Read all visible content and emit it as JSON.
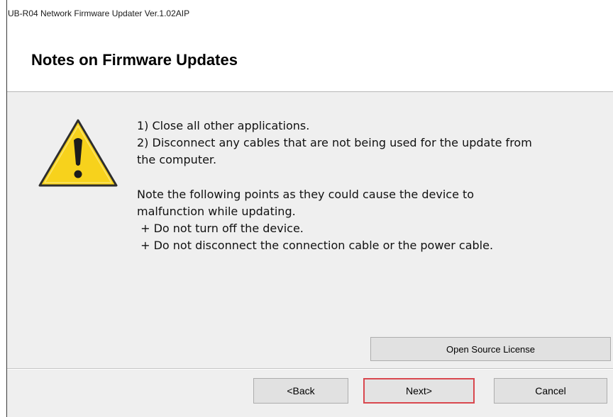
{
  "window": {
    "title": "UB-R04 Network Firmware Updater Ver.1.02AIP"
  },
  "header": {
    "heading": "Notes on Firmware Updates"
  },
  "message": {
    "icon": "warning-triangle-icon",
    "lines": [
      "1) Close all other applications.",
      "2) Disconnect any cables that are not being used for the update from",
      "the computer.",
      "",
      "Note the following points as they could cause the device to",
      "malfunction while updating.",
      " + Do not turn off the device.",
      " + Do not disconnect the connection cable or the power cable."
    ]
  },
  "buttons": {
    "open_source_license": "Open Source License",
    "back": "<Back",
    "next": "Next>",
    "cancel": "Cancel"
  },
  "colors": {
    "content_background": "#efefef",
    "button_face": "#e1e1e1",
    "highlight_border": "#d9474e",
    "warning_yellow": "#f7d21c"
  }
}
